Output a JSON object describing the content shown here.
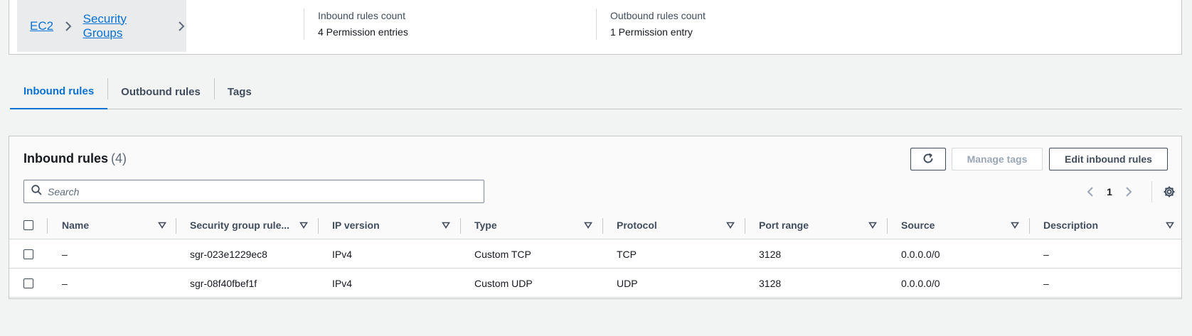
{
  "breadcrumb": {
    "items": [
      "EC2",
      "Security Groups"
    ]
  },
  "summary": {
    "inbound": {
      "label": "Inbound rules count",
      "value": "4 Permission entries"
    },
    "outbound": {
      "label": "Outbound rules count",
      "value": "1 Permission entry"
    }
  },
  "tabs": [
    {
      "label": "Inbound rules",
      "active": true
    },
    {
      "label": "Outbound rules",
      "active": false
    },
    {
      "label": "Tags",
      "active": false
    }
  ],
  "panel": {
    "title": "Inbound rules",
    "count": "(4)",
    "manage_tags_label": "Manage tags",
    "edit_label": "Edit inbound rules",
    "search_placeholder": "Search",
    "page": "1"
  },
  "table": {
    "columns": [
      "Name",
      "Security group rule...",
      "IP version",
      "Type",
      "Protocol",
      "Port range",
      "Source",
      "Description"
    ],
    "rows": [
      [
        "–",
        "sgr-023e1229ec8",
        "IPv4",
        "Custom TCP",
        "TCP",
        "3128",
        "0.0.0.0/0",
        "–"
      ],
      [
        "–",
        "sgr-08f40fbef1f",
        "IPv4",
        "Custom UDP",
        "UDP",
        "3128",
        "0.0.0.0/0",
        "–"
      ]
    ]
  },
  "colors": {
    "link": "#0972d3",
    "text": "#16191f",
    "muted": "#414d5c",
    "background": "#f2f3f3"
  }
}
